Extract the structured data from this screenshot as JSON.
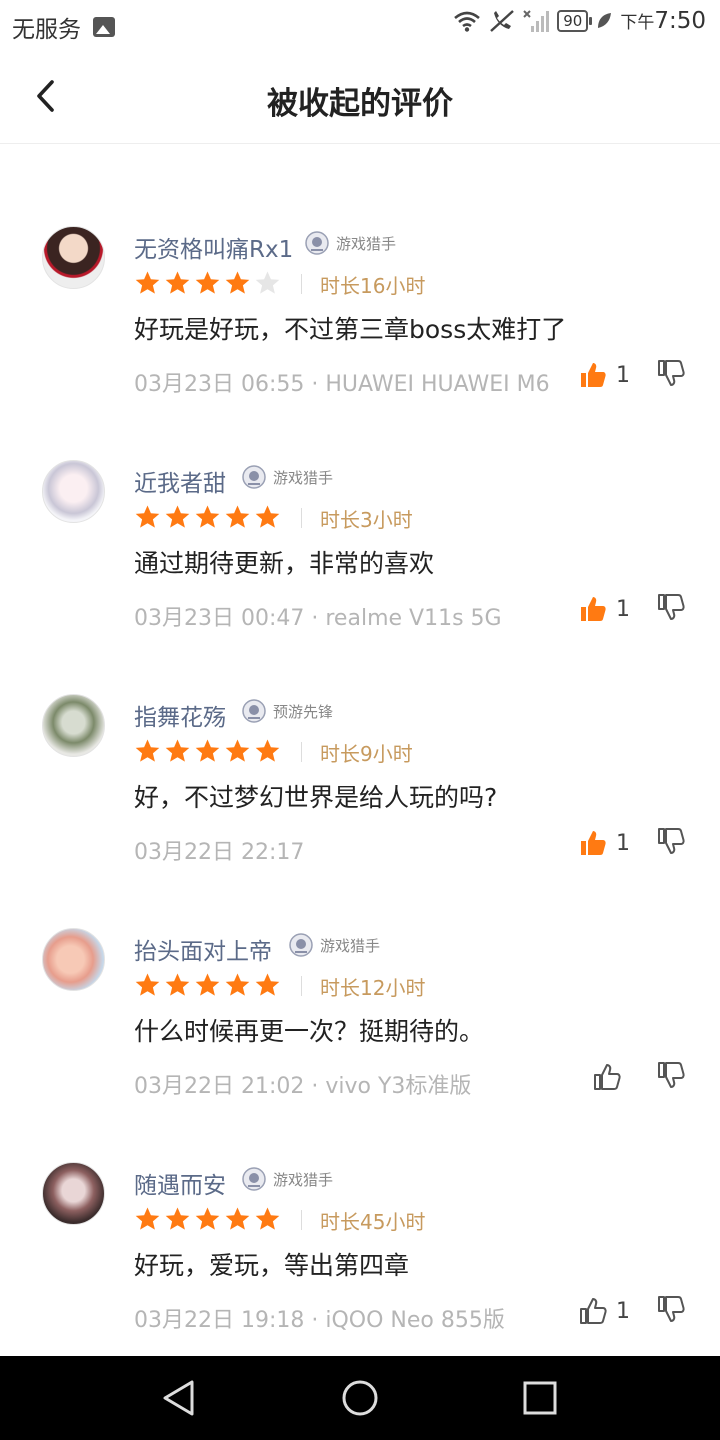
{
  "status_bar": {
    "carrier": "无服务",
    "battery": "90",
    "period": "下午",
    "time": "7:50"
  },
  "header": {
    "title": "被收起的评价",
    "back_icon": "chevron-left-icon"
  },
  "colors": {
    "star_filled": "#ff7a12",
    "star_empty": "#e6e6e6",
    "like_active": "#ff7a12",
    "username": "#5b6a88",
    "duration": "#c79a5e"
  },
  "reviews": [
    {
      "username": "无资格叫痛Rx1",
      "badge": "游戏猎手",
      "rating": 4,
      "duration": "时长16小时",
      "content": "好玩是好玩，不过第三章boss太难打了",
      "date": "03月23日 06:55",
      "device": "HUAWEI HUAWEI M6",
      "likes": "1",
      "liked": true
    },
    {
      "username": "近我者甜",
      "badge": "游戏猎手",
      "rating": 5,
      "duration": "时长3小时",
      "content": "通过期待更新，非常的喜欢",
      "date": "03月23日 00:47",
      "device": "realme V11s 5G",
      "likes": "1",
      "liked": true
    },
    {
      "username": "指舞花殇",
      "badge": "预游先锋",
      "rating": 5,
      "duration": "时长9小时",
      "content": "好，不过梦幻世界是给人玩的吗?",
      "date": "03月22日 22:17",
      "device": "",
      "likes": "1",
      "liked": true
    },
    {
      "username": "抬头面对上帝",
      "badge": "游戏猎手",
      "rating": 5,
      "duration": "时长12小时",
      "content": "什么时候再更一次？挺期待的。",
      "date": "03月22日 21:02",
      "device": "vivo Y3标准版",
      "likes": "",
      "liked": false
    },
    {
      "username": "随遇而安",
      "badge": "游戏猎手",
      "rating": 5,
      "duration": "时长45小时",
      "content": "好玩，爱玩，等出第四章",
      "date": "03月22日 19:18",
      "device": "iQOO Neo 855版",
      "likes": "1",
      "liked": false
    }
  ],
  "nav": {
    "back_icon": "triangle-back-icon",
    "home_icon": "circle-home-icon",
    "recents_icon": "square-recents-icon"
  }
}
